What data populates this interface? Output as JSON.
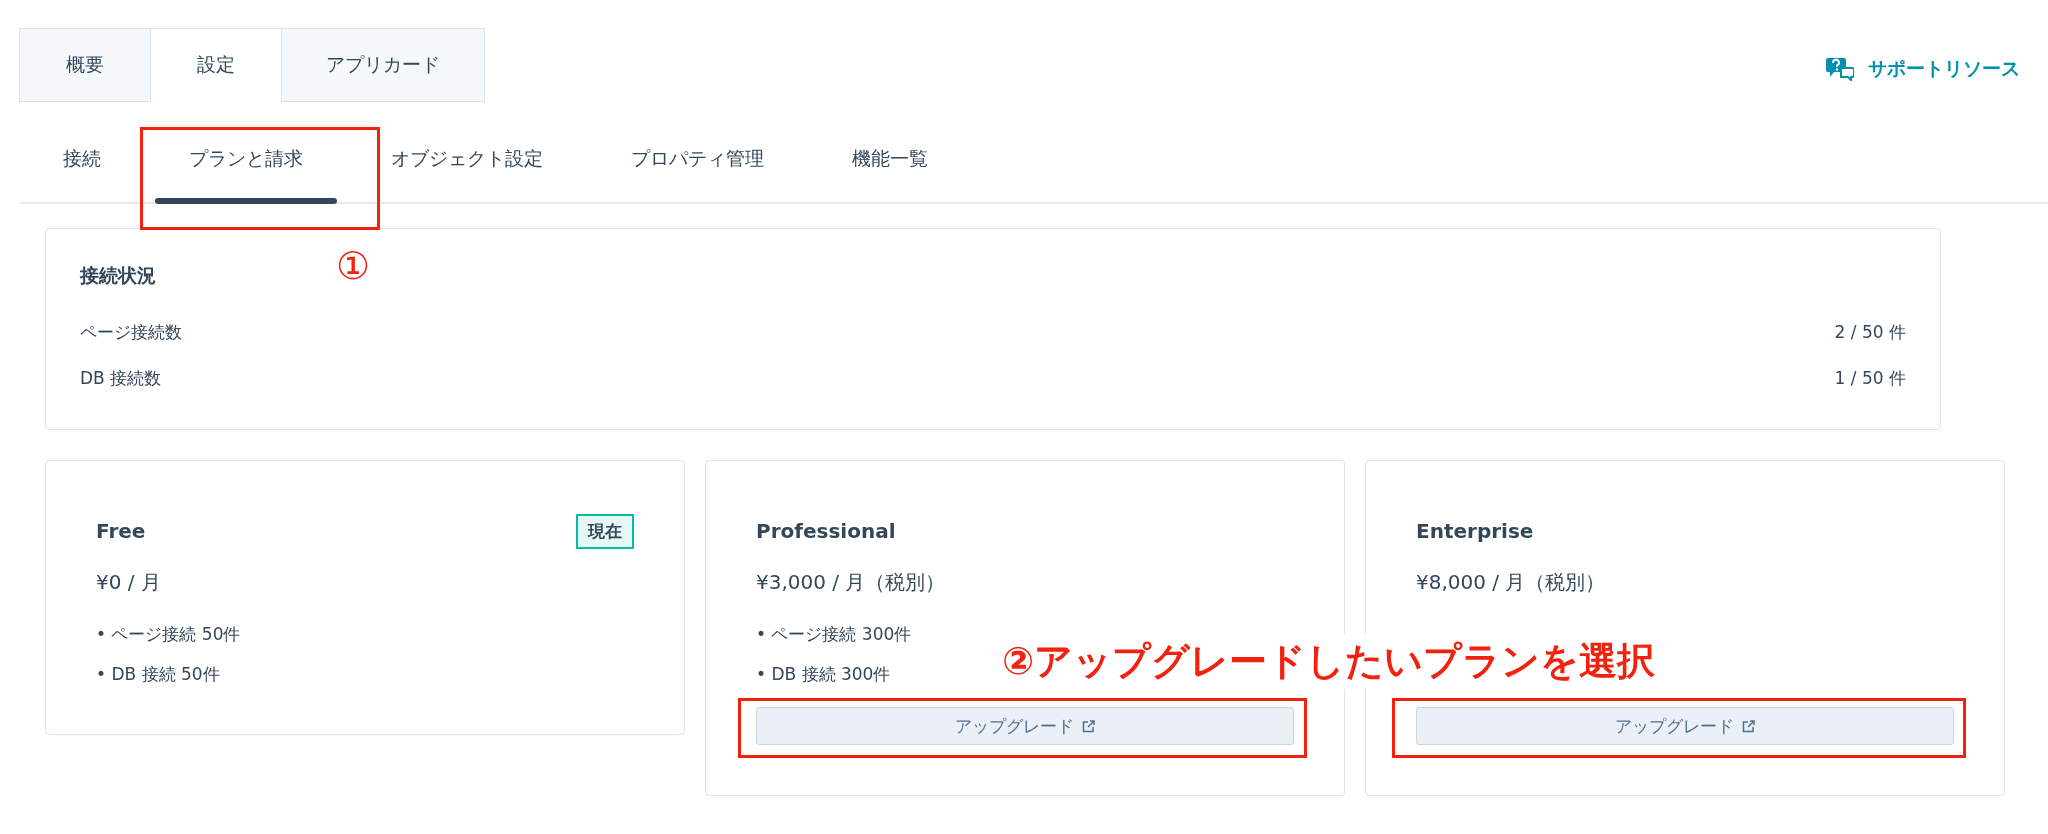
{
  "tabs": [
    {
      "label": "概要",
      "selected": false
    },
    {
      "label": "設定",
      "selected": true
    },
    {
      "label": "アプリカード",
      "selected": false
    }
  ],
  "support_link": "サポートリソース",
  "subtabs": [
    {
      "label": "接続",
      "selected": false
    },
    {
      "label": "プランと請求",
      "selected": true
    },
    {
      "label": "オブジェクト設定",
      "selected": false
    },
    {
      "label": "プロパティ管理",
      "selected": false
    },
    {
      "label": "機能一覧",
      "selected": false
    }
  ],
  "status": {
    "title": "接続状況",
    "rows": [
      {
        "label": "ページ接続数",
        "value": "2 / 50 件"
      },
      {
        "label": "DB 接続数",
        "value": "1 / 50 件"
      }
    ]
  },
  "plans": [
    {
      "name": "Free",
      "badge": "現在",
      "price": "¥0 / 月",
      "features": [
        "• ページ接続 50件",
        "• DB 接続 50件"
      ]
    },
    {
      "name": "Professional",
      "price": "¥3,000 / 月（税別）",
      "features": [
        "• ページ接続 300件",
        "• DB 接続 300件"
      ],
      "button": "アップグレード"
    },
    {
      "name": "Enterprise",
      "price": "¥8,000 / 月（税別）",
      "button": "アップグレード"
    }
  ],
  "annotations": {
    "step1": "①",
    "step2": "②アップグレードしたいプランを選択"
  }
}
